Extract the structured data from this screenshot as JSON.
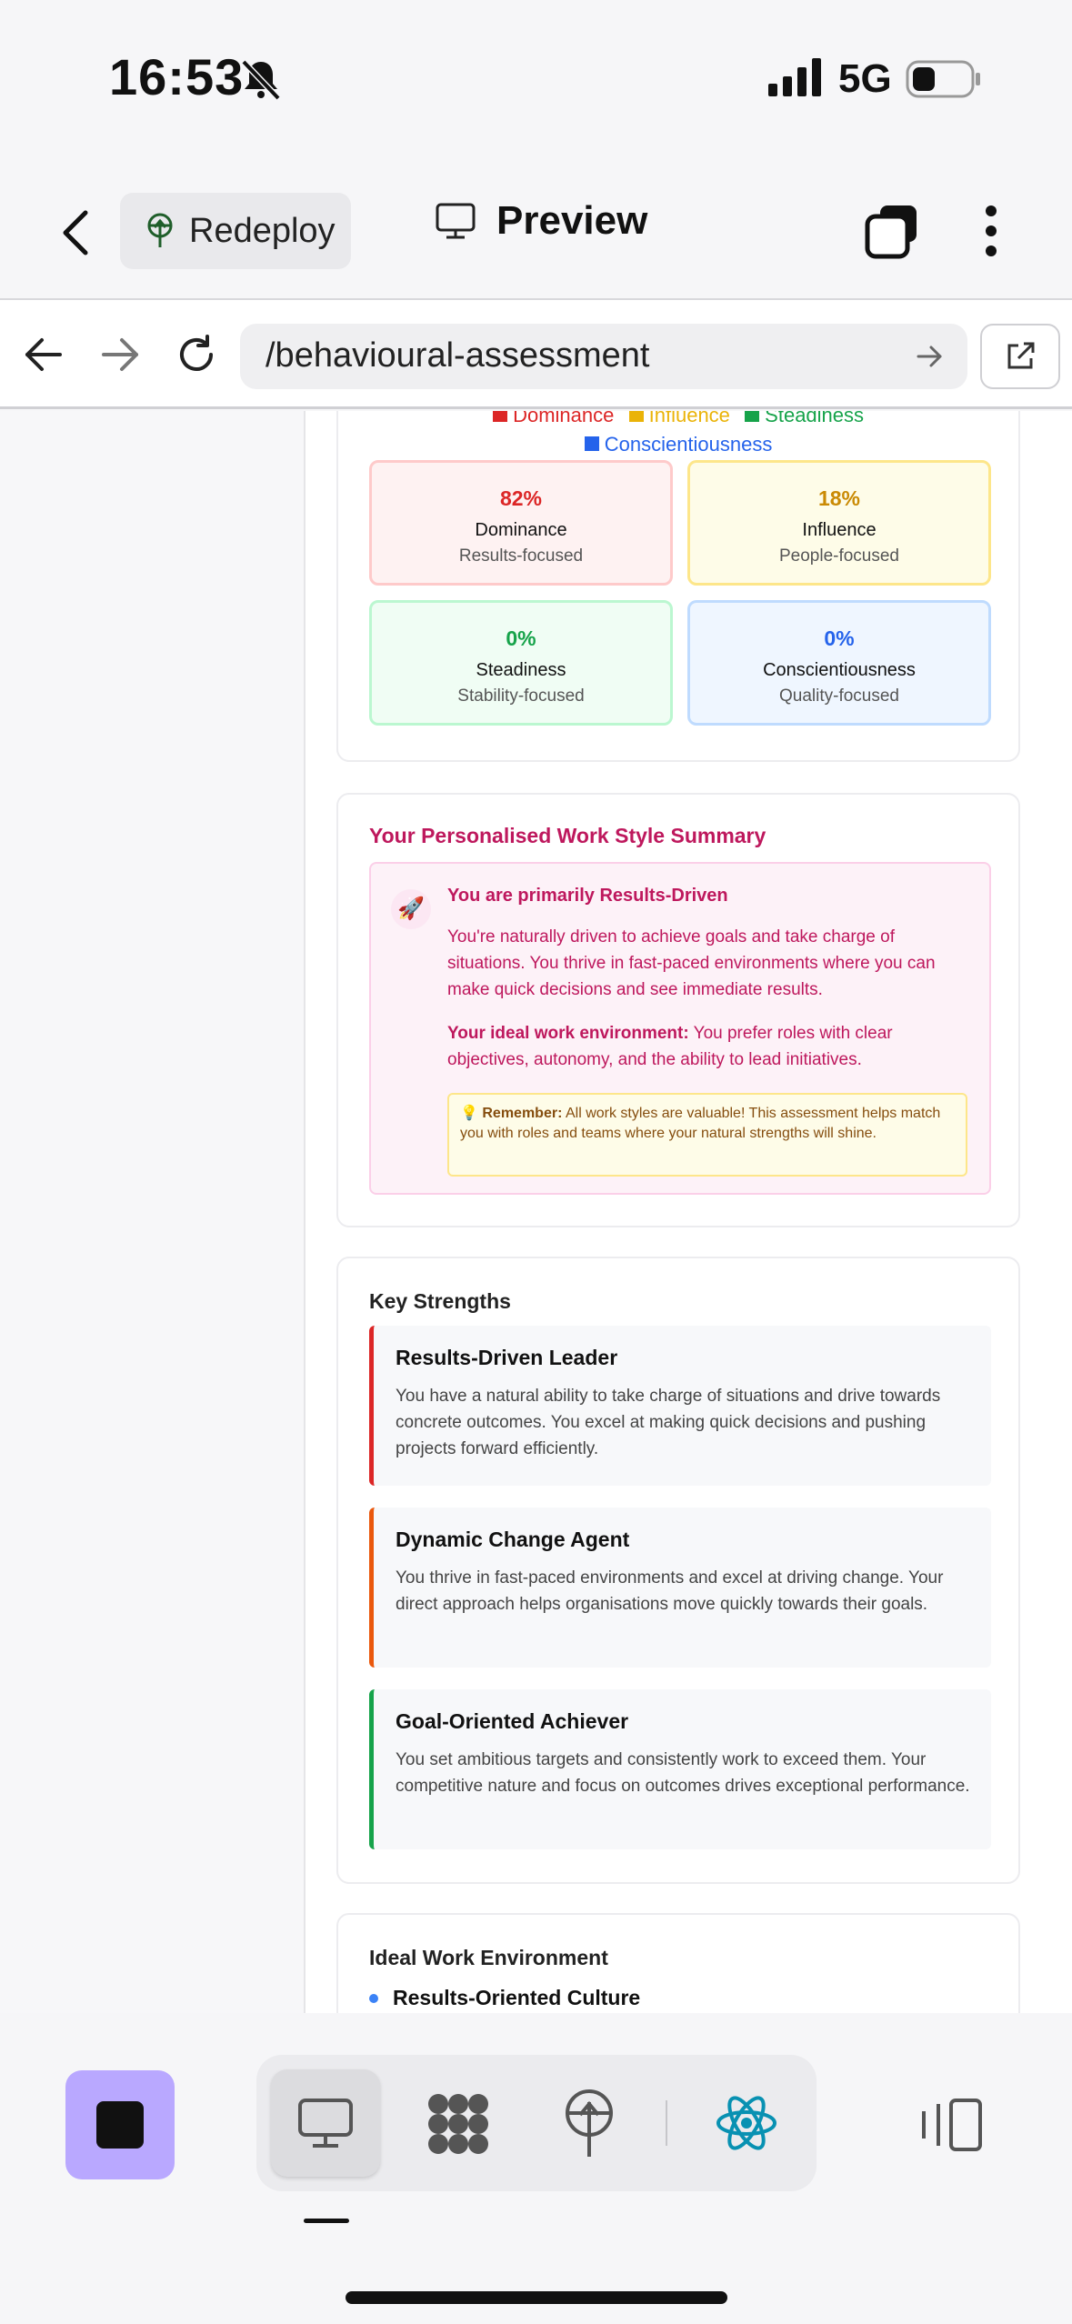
{
  "status_bar": {
    "time": "16:53",
    "network": "5G"
  },
  "app_bar": {
    "redeploy_label": "Redeploy",
    "preview_label": "Preview"
  },
  "browser": {
    "url": "/behavioural-assessment"
  },
  "disc_card": {
    "legend": [
      "Dominance",
      "Influence",
      "Steadiness",
      "Conscientiousness"
    ],
    "tiles": [
      {
        "percent": "82%",
        "name": "Dominance",
        "subtitle": "Results-focused",
        "color": "#dc2626"
      },
      {
        "percent": "18%",
        "name": "Influence",
        "subtitle": "People-focused",
        "color": "#ca8a04"
      },
      {
        "percent": "0%",
        "name": "Steadiness",
        "subtitle": "Stability-focused",
        "color": "#16a34a"
      },
      {
        "percent": "0%",
        "name": "Conscientiousness",
        "subtitle": "Quality-focused",
        "color": "#2563eb"
      }
    ]
  },
  "summary": {
    "title": "Your Personalised Work Style Summary",
    "heading": "You are primarily Results-Driven",
    "body": "You're naturally driven to achieve goals and take charge of situations. You thrive in fast-paced environments where you can make quick decisions and see immediate results.",
    "env_label": "Your ideal work environment:",
    "env_text": " You prefer roles with clear objectives, autonomy, and the ability to lead initiatives.",
    "remember_label": "Remember:",
    "remember_text": " All work styles are valuable! This assessment helps match you with roles and teams where your natural strengths will shine.",
    "accent": "#be185d"
  },
  "strengths": {
    "title": "Key Strengths",
    "items": [
      {
        "title": "Results-Driven Leader",
        "description": "You have a natural ability to take charge of situations and drive towards concrete outcomes. You excel at making quick decisions and pushing projects forward efficiently.",
        "color": "#dc2626"
      },
      {
        "title": "Dynamic Change Agent",
        "description": "You thrive in fast-paced environments and excel at driving change. Your direct approach helps organisations move quickly towards their goals.",
        "color": "#ea580c"
      },
      {
        "title": "Goal-Oriented Achiever",
        "description": "You set ambitious targets and consistently work to exceed them. Your competitive nature and focus on outcomes drives exceptional performance.",
        "color": "#16a34a"
      }
    ]
  },
  "environment": {
    "title": "Ideal Work Environment",
    "first_item": "Results-Oriented Culture"
  }
}
